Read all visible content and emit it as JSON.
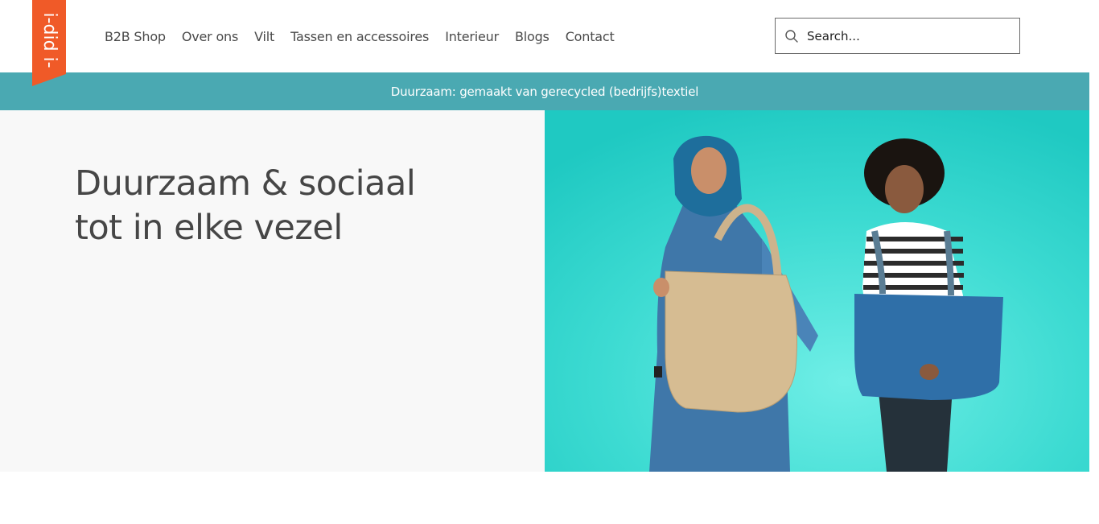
{
  "header": {
    "logo_text": "i-did i-",
    "logo_color": "#f05a28",
    "nav": [
      {
        "label": "B2B Shop"
      },
      {
        "label": "Over ons"
      },
      {
        "label": "Vilt"
      },
      {
        "label": "Tassen en accessoires"
      },
      {
        "label": "Interieur"
      },
      {
        "label": "Blogs"
      },
      {
        "label": "Contact"
      }
    ],
    "search": {
      "placeholder": "Search...",
      "icon": "search-icon"
    }
  },
  "banner": {
    "text": "Duurzaam: gemaakt van gerecycled (bedrijfs)textiel",
    "color": "#4aa9b2"
  },
  "hero": {
    "title_line1": "Duurzaam & sociaal",
    "title_line2": "tot in elke vezel",
    "image": "two-women-holding-felt-tote-bags",
    "image_bg": "#2ed6cd"
  }
}
